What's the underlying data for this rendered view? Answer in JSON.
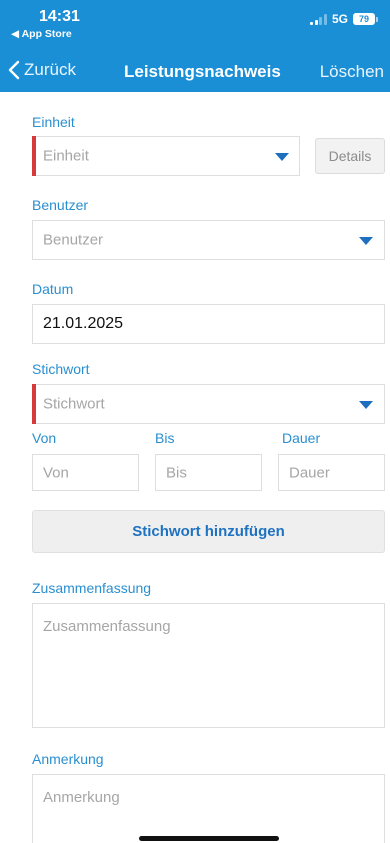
{
  "status_bar": {
    "time": "14:31",
    "back_app": "◀ App Store",
    "network": "5G",
    "battery": "79"
  },
  "nav": {
    "back_label": "Zurück",
    "title": "Leistungsnachweis",
    "delete_label": "Löschen"
  },
  "form": {
    "einheit": {
      "label": "Einheit",
      "placeholder": "Einheit",
      "details_label": "Details"
    },
    "benutzer": {
      "label": "Benutzer",
      "placeholder": "Benutzer"
    },
    "datum": {
      "label": "Datum",
      "value": "21.01.2025"
    },
    "stichwort": {
      "label": "Stichwort",
      "placeholder": "Stichwort"
    },
    "von": {
      "label": "Von",
      "placeholder": "Von"
    },
    "bis": {
      "label": "Bis",
      "placeholder": "Bis"
    },
    "dauer": {
      "label": "Dauer",
      "placeholder": "Dauer"
    },
    "add_keyword_label": "Stichwort hinzufügen",
    "zusammenfassung": {
      "label": "Zusammenfassung",
      "placeholder": "Zusammenfassung"
    },
    "anmerkung": {
      "label": "Anmerkung",
      "placeholder": "Anmerkung"
    }
  },
  "colors": {
    "header_bg": "#1a8fd6",
    "label": "#2a8fd0",
    "required_marker": "#d63b3b",
    "accent_button_text": "#1f72c2"
  }
}
